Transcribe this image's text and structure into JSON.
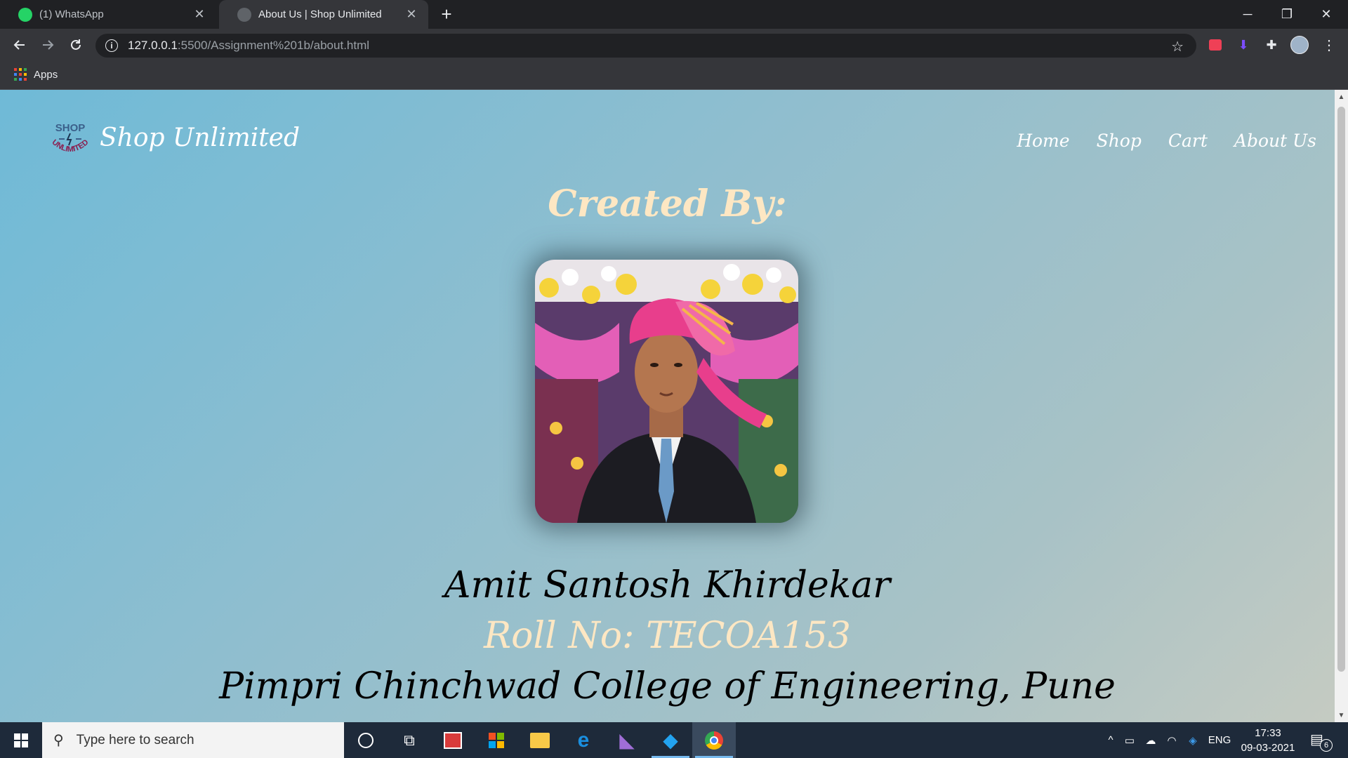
{
  "browser": {
    "tabs": [
      {
        "title": "(1) WhatsApp",
        "active": false,
        "favicon": "whatsapp-icon"
      },
      {
        "title": "About Us | Shop Unlimited",
        "active": true,
        "favicon": "globe-icon"
      }
    ],
    "close_glyph": "✕",
    "new_tab_glyph": "+",
    "window_controls": {
      "minimize": "─",
      "maximize": "❐",
      "close": "✕"
    },
    "address": {
      "host": "127.0.0.1",
      "rest": ":5500/Assignment%201b/about.html"
    },
    "bookmarks": [
      {
        "label": "Apps",
        "icon": "apps-grid-icon"
      }
    ]
  },
  "site": {
    "brand": "Shop Unlimited",
    "logo": {
      "top": "SHOP",
      "bottom": "UNLIMITED"
    },
    "nav": [
      "Home",
      "Shop",
      "Cart",
      "About Us"
    ],
    "heading": "Created By:",
    "name": "Amit Santosh Khirdekar",
    "roll": "Roll No: TECOA153",
    "college": "Pimpri Chinchwad College of Engineering, Pune"
  },
  "colors": {
    "accent_text": "#fde7c3",
    "page_gradient": [
      "#6fbad7",
      "#c5cbc2"
    ],
    "taskbar": "#1e2a3a"
  },
  "taskbar": {
    "search_placeholder": "Type here to search",
    "pinned": [
      "cortana-icon",
      "task-view-icon",
      "gift-icon",
      "store-icon",
      "file-explorer-icon",
      "edge-icon",
      "visual-studio-icon",
      "vscode-icon",
      "chrome-icon"
    ],
    "tray": {
      "language": "ENG",
      "time": "17:33",
      "date": "09-03-2021",
      "notifications": "6"
    }
  }
}
